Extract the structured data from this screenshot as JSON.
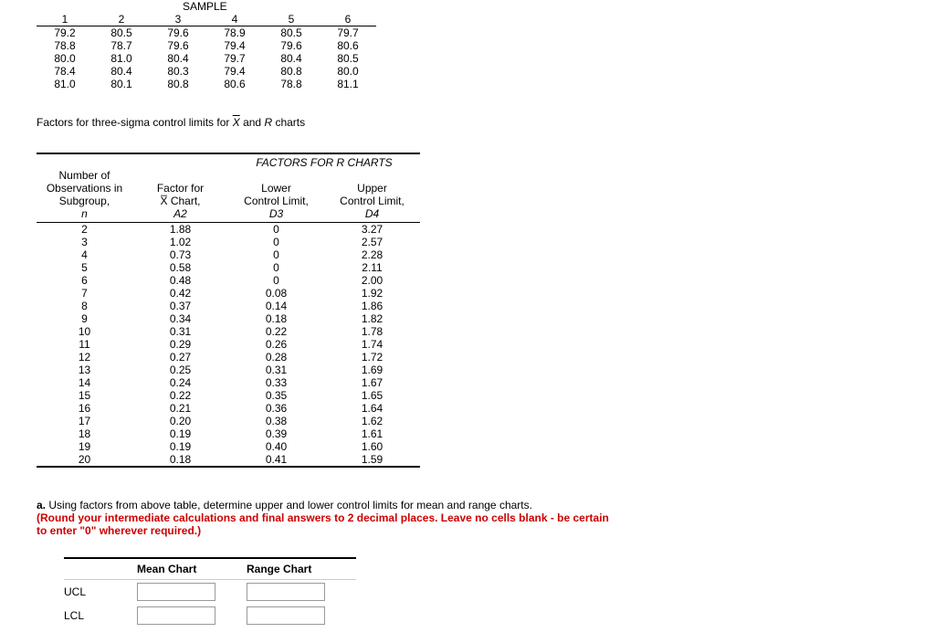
{
  "sample": {
    "title": "SAMPLE",
    "headers": [
      "1",
      "2",
      "3",
      "4",
      "5",
      "6"
    ],
    "rows": [
      [
        "79.2",
        "80.5",
        "79.6",
        "78.9",
        "80.5",
        "79.7"
      ],
      [
        "78.8",
        "78.7",
        "79.6",
        "79.4",
        "79.6",
        "80.6"
      ],
      [
        "80.0",
        "81.0",
        "80.4",
        "79.7",
        "80.4",
        "80.5"
      ],
      [
        "78.4",
        "80.4",
        "80.3",
        "79.4",
        "80.8",
        "80.0"
      ],
      [
        "81.0",
        "80.1",
        "80.8",
        "80.6",
        "78.8",
        "81.1"
      ]
    ]
  },
  "factors_caption_prefix": "Factors for three-sigma control limits for ",
  "factors_caption_mid": " and ",
  "factors_caption_R": "R",
  "factors_caption_suffix": " charts",
  "factors": {
    "rcharts_label": "FACTORS FOR R CHARTS",
    "header": {
      "n_line1": "Number of",
      "n_line2": "Observations in",
      "n_line3": "Subgroup,",
      "n_line4": "n",
      "a2_line1": "Factor for",
      "a2_line2": "X̅ Chart,",
      "a2_line3": "A2",
      "d3_line1": "Lower",
      "d3_line2": "Control Limit,",
      "d3_line3": "D3",
      "d4_line1": "Upper",
      "d4_line2": "Control Limit,",
      "d4_line3": "D4"
    },
    "rows": [
      {
        "n": "2",
        "a2": "1.88",
        "d3": "0",
        "d4": "3.27"
      },
      {
        "n": "3",
        "a2": "1.02",
        "d3": "0",
        "d4": "2.57"
      },
      {
        "n": "4",
        "a2": "0.73",
        "d3": "0",
        "d4": "2.28"
      },
      {
        "n": "5",
        "a2": "0.58",
        "d3": "0",
        "d4": "2.11"
      },
      {
        "n": "6",
        "a2": "0.48",
        "d3": "0",
        "d4": "2.00"
      },
      {
        "n": "7",
        "a2": "0.42",
        "d3": "0.08",
        "d4": "1.92"
      },
      {
        "n": "8",
        "a2": "0.37",
        "d3": "0.14",
        "d4": "1.86"
      },
      {
        "n": "9",
        "a2": "0.34",
        "d3": "0.18",
        "d4": "1.82"
      },
      {
        "n": "10",
        "a2": "0.31",
        "d3": "0.22",
        "d4": "1.78"
      },
      {
        "n": "11",
        "a2": "0.29",
        "d3": "0.26",
        "d4": "1.74"
      },
      {
        "n": "12",
        "a2": "0.27",
        "d3": "0.28",
        "d4": "1.72"
      },
      {
        "n": "13",
        "a2": "0.25",
        "d3": "0.31",
        "d4": "1.69"
      },
      {
        "n": "14",
        "a2": "0.24",
        "d3": "0.33",
        "d4": "1.67"
      },
      {
        "n": "15",
        "a2": "0.22",
        "d3": "0.35",
        "d4": "1.65"
      },
      {
        "n": "16",
        "a2": "0.21",
        "d3": "0.36",
        "d4": "1.64"
      },
      {
        "n": "17",
        "a2": "0.20",
        "d3": "0.38",
        "d4": "1.62"
      },
      {
        "n": "18",
        "a2": "0.19",
        "d3": "0.39",
        "d4": "1.61"
      },
      {
        "n": "19",
        "a2": "0.19",
        "d3": "0.40",
        "d4": "1.60"
      },
      {
        "n": "20",
        "a2": "0.18",
        "d3": "0.41",
        "d4": "1.59"
      }
    ]
  },
  "question": {
    "letter": "a.",
    "text": "Using factors from above table, determine upper and lower control limits for mean and range charts.",
    "red": "(Round your intermediate calculations and final answers to 2 decimal places. Leave no cells blank - be certain to enter \"0\" wherever required.)"
  },
  "answer": {
    "col_mean": "Mean Chart",
    "col_range": "Range Chart",
    "row_ucl": "UCL",
    "row_lcl": "LCL"
  },
  "chart_data": {
    "type": "table",
    "title": "SAMPLE — subgroup observations (columns = samples 1..6, rows = 5 subgroups)",
    "columns": [
      "1",
      "2",
      "3",
      "4",
      "5",
      "6"
    ],
    "rows": [
      [
        79.2,
        80.5,
        79.6,
        78.9,
        80.5,
        79.7
      ],
      [
        78.8,
        78.7,
        79.6,
        79.4,
        79.6,
        80.6
      ],
      [
        80.0,
        81.0,
        80.4,
        79.7,
        80.4,
        80.5
      ],
      [
        78.4,
        80.4,
        80.3,
        79.4,
        80.8,
        80.0
      ],
      [
        81.0,
        80.1,
        80.8,
        80.6,
        78.8,
        81.1
      ]
    ]
  }
}
